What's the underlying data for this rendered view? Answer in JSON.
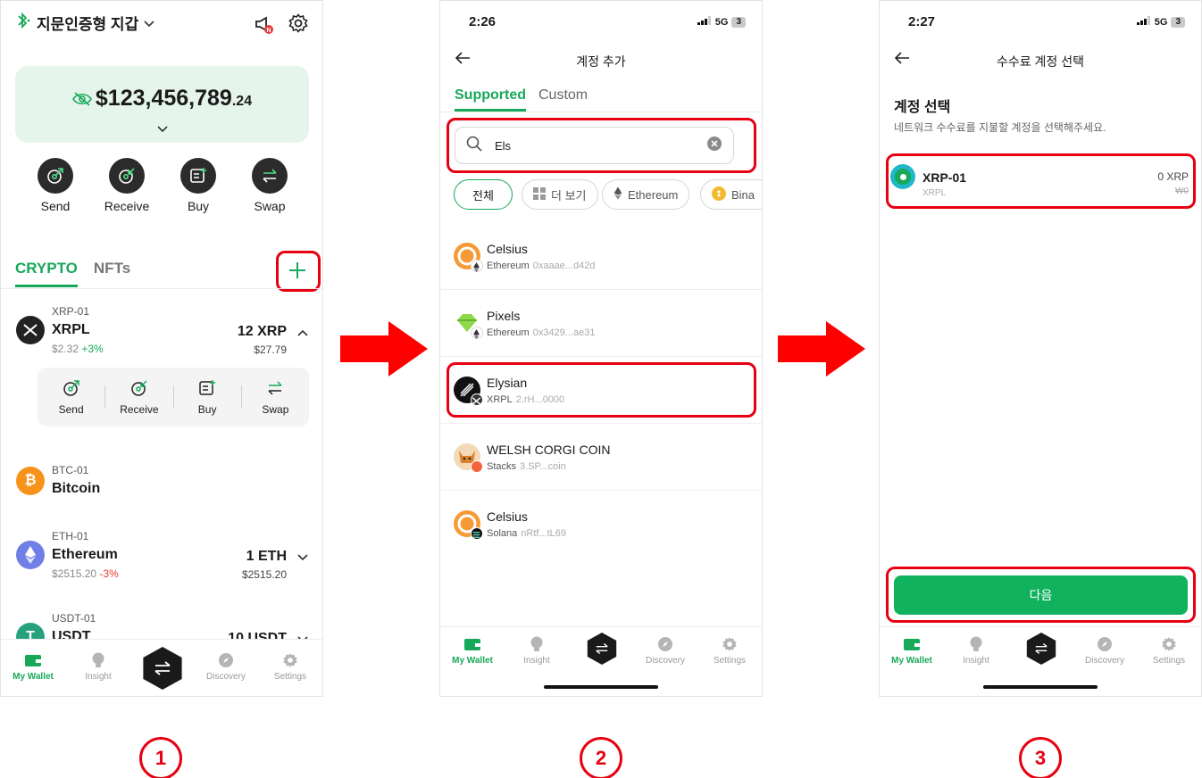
{
  "panel1": {
    "wallet_title": "지문인증형 지갑",
    "balance_main": "$123,456,789",
    "balance_cents": ".24",
    "actions": [
      "Send",
      "Receive",
      "Buy",
      "Swap"
    ],
    "tabs": [
      "CRYPTO",
      "NFTs"
    ],
    "assets": [
      {
        "account": "XRP-01",
        "name": "XRPL",
        "price": "$2.32",
        "change": "+3%",
        "amount": "12 XRP",
        "value": "$27.79"
      },
      {
        "account": "BTC-01",
        "name": "Bitcoin"
      },
      {
        "account": "ETH-01",
        "name": "Ethereum",
        "price": "$2515.20",
        "change": "-3%",
        "amount": "1 ETH",
        "value": "$2515.20"
      },
      {
        "account": "USDT-01",
        "name": "USDT",
        "amount": "10 USDT"
      }
    ],
    "sub_actions": [
      "Send",
      "Receive",
      "Buy",
      "Swap"
    ]
  },
  "nav": [
    "My Wallet",
    "Insight",
    "Discovery",
    "Settings"
  ],
  "panel2": {
    "time": "2:26",
    "network": "5G",
    "battery": "3",
    "title": "계정 추가",
    "tabs": [
      "Supported",
      "Custom"
    ],
    "search_value": "Els",
    "chips": [
      "전체",
      "더 보기",
      "Ethereum",
      "Bina"
    ],
    "tokens": [
      {
        "name": "Celsius",
        "network": "Ethereum",
        "address": "0xaaae...d42d"
      },
      {
        "name": "Pixels",
        "network": "Ethereum",
        "address": "0x3429...ae31"
      },
      {
        "name": "Elysian",
        "network": "XRPL",
        "address": "2.rH...0000"
      },
      {
        "name": "WELSH CORGI COIN",
        "network": "Stacks",
        "address": "3.SP...coin"
      },
      {
        "name": "Celsius",
        "network": "Solana",
        "address": "nRtf...tL69"
      }
    ]
  },
  "panel3": {
    "time": "2:27",
    "network": "5G",
    "battery": "3",
    "title": "수수료 계정 선택",
    "heading": "계정 선택",
    "description": "네트워크 수수료를 지불할 계정을 선택해주세요.",
    "account_name": "XRP-01",
    "account_network": "XRPL",
    "account_amount": "0 XRP",
    "account_value": "₩0",
    "next_label": "다음"
  },
  "steps": [
    "1",
    "2",
    "3"
  ],
  "colors": {
    "accent": "#17a85a",
    "highlight": "#e60012",
    "button": "#10b25e"
  }
}
